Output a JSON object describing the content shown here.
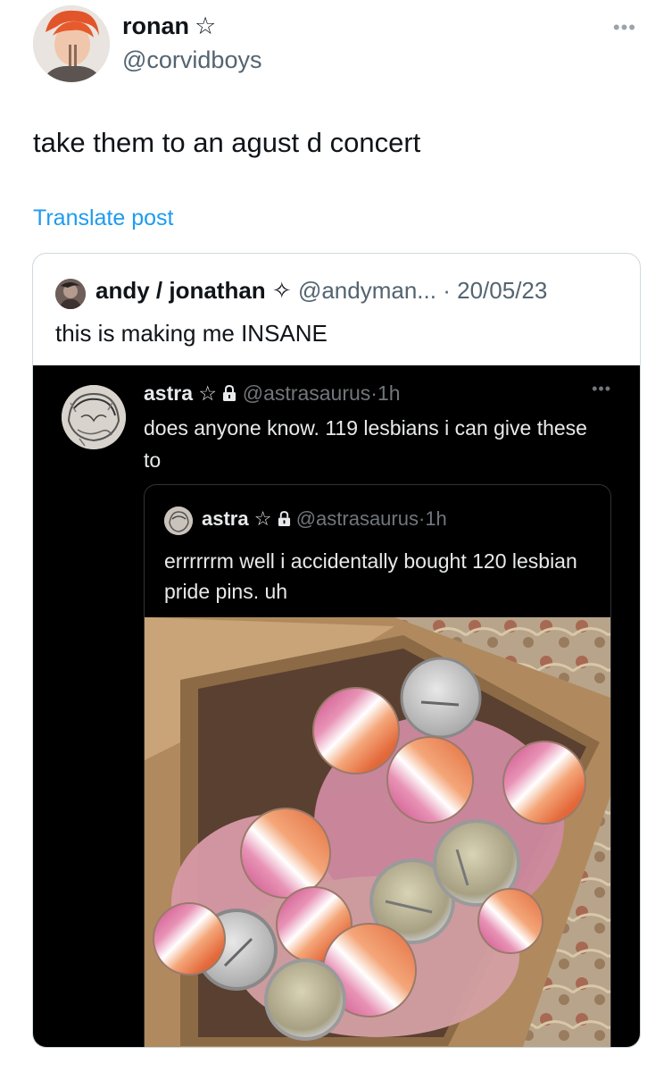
{
  "post": {
    "author_name": "ronan",
    "author_badge": "☆",
    "author_handle": "@corvidboys",
    "more_icon": "ellipsis-icon",
    "text": "take them to an agust d concert",
    "translate_label": "Translate post",
    "link_color": "#1d9bf0"
  },
  "quote": {
    "author_name": "andy / jonathan",
    "author_badge": "✧",
    "author_handle": "@andyman...",
    "separator": "·",
    "date": "20/05/23",
    "text": "this is making me INSANE",
    "screenshot": {
      "author_name": "astra",
      "author_badge": "☆",
      "lock_icon": "lock-icon",
      "author_handle": "@astrasaurus",
      "separator": "·",
      "time": "1h",
      "text": "does anyone know. 119 lesbians i can give these to",
      "inner": {
        "author_name": "astra",
        "author_badge": "☆",
        "lock_icon": "lock-icon",
        "author_handle": "@astrasaurus",
        "separator": "·",
        "time": "1h",
        "text": "errrrrrm well i accidentally  bought 120 lesbian pride pins. uh",
        "photo": "box-of-lesbian-pride-pins-photo"
      }
    }
  }
}
